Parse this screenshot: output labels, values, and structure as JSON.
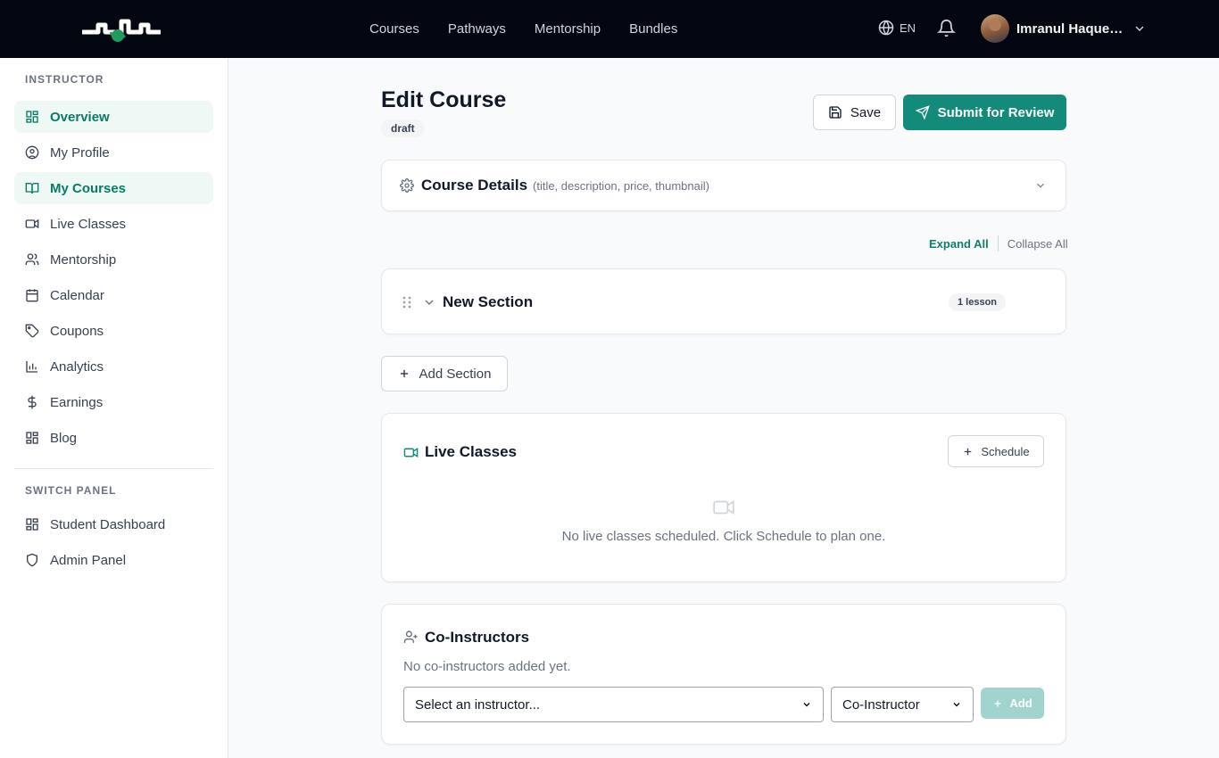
{
  "header": {
    "nav": [
      "Courses",
      "Pathways",
      "Mentorship",
      "Bundles"
    ],
    "language": "EN",
    "user_name": "Imranul Haque Mahmud"
  },
  "sidebar": {
    "instructor_label": "INSTRUCTOR",
    "items": [
      {
        "label": "Overview",
        "icon": "grid-icon"
      },
      {
        "label": "My Profile",
        "icon": "user-circle-icon"
      },
      {
        "label": "My Courses",
        "icon": "book-icon"
      },
      {
        "label": "Live Classes",
        "icon": "video-icon"
      },
      {
        "label": "Mentorship",
        "icon": "users-icon"
      },
      {
        "label": "Calendar",
        "icon": "calendar-icon"
      },
      {
        "label": "Coupons",
        "icon": "tag-icon"
      },
      {
        "label": "Analytics",
        "icon": "bar-chart-icon"
      },
      {
        "label": "Earnings",
        "icon": "dollar-icon"
      },
      {
        "label": "Blog",
        "icon": "grid-icon"
      }
    ],
    "switch_label": "SWITCH PANEL",
    "switch_items": [
      {
        "label": "Student Dashboard",
        "icon": "grid-icon"
      },
      {
        "label": "Admin Panel",
        "icon": "shield-icon"
      }
    ]
  },
  "main": {
    "title": "Edit Course",
    "status": "draft",
    "save_label": "Save",
    "submit_label": "Submit for Review",
    "course_details": {
      "title": "Course Details",
      "hint": "(title, description, price, thumbnail)"
    },
    "expand_all": "Expand All",
    "collapse_all": "Collapse All",
    "section": {
      "title": "New Section",
      "lesson_count": "1 lesson"
    },
    "add_section_label": "Add Section",
    "live_classes": {
      "title": "Live Classes",
      "schedule_label": "Schedule",
      "empty_text": "No live classes scheduled. Click Schedule to plan one."
    },
    "co_instructors": {
      "title": "Co-Instructors",
      "empty_text": "No co-instructors added yet.",
      "instructor_select": "Select an instructor...",
      "role_select": "Co-Instructor",
      "add_label": "Add"
    }
  },
  "colors": {
    "brand": "#138a7a",
    "nav_bg": "#030712",
    "active_bg": "#eef8f4"
  }
}
